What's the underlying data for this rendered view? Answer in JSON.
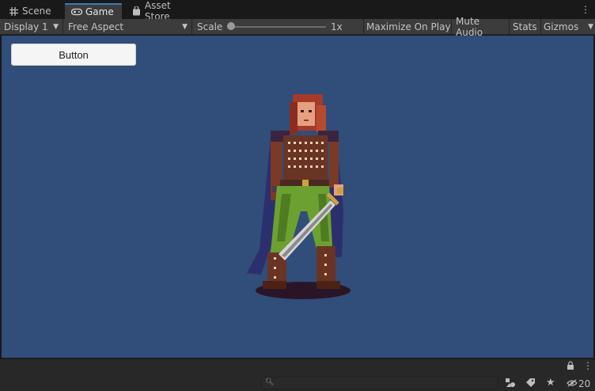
{
  "tabs": [
    {
      "label": "Scene",
      "icon": "hash-icon"
    },
    {
      "label": "Game",
      "icon": "gamepad-icon"
    },
    {
      "label": "Asset Store",
      "icon": "bag-icon"
    }
  ],
  "toolbar": {
    "display": "Display 1",
    "aspect": "Free Aspect",
    "scale_label": "Scale",
    "scale_value": "1x",
    "maximize": "Maximize On Play",
    "mute": "Mute Audio",
    "stats": "Stats",
    "gizmos": "Gizmos"
  },
  "game": {
    "button_label": "Button",
    "background_color": "#314d79"
  },
  "statusbar": {
    "hidden_count": "20"
  }
}
